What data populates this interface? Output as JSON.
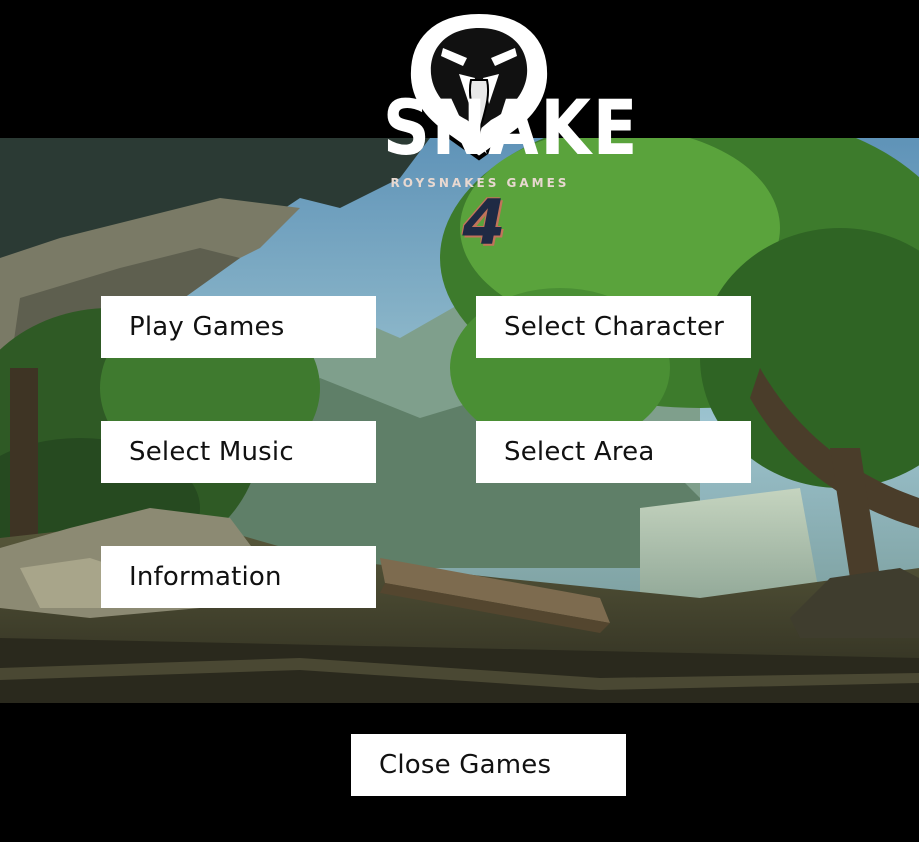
{
  "logo": {
    "title": "SNAKE",
    "subtitle": "ROYSNAKES GAMES",
    "number": "4",
    "icon": "cobra-head-icon"
  },
  "menu": {
    "play_games": "Play Games",
    "select_character": "Select Character",
    "select_music": "Select Music",
    "select_area": "Select Area",
    "information": "Information",
    "close_games": "Close Games"
  },
  "colors": {
    "background": "#000000",
    "button_bg": "#ffffff",
    "button_text": "#111111",
    "logo_number": "#1f2a44",
    "logo_number_outline": "#c2735a"
  }
}
